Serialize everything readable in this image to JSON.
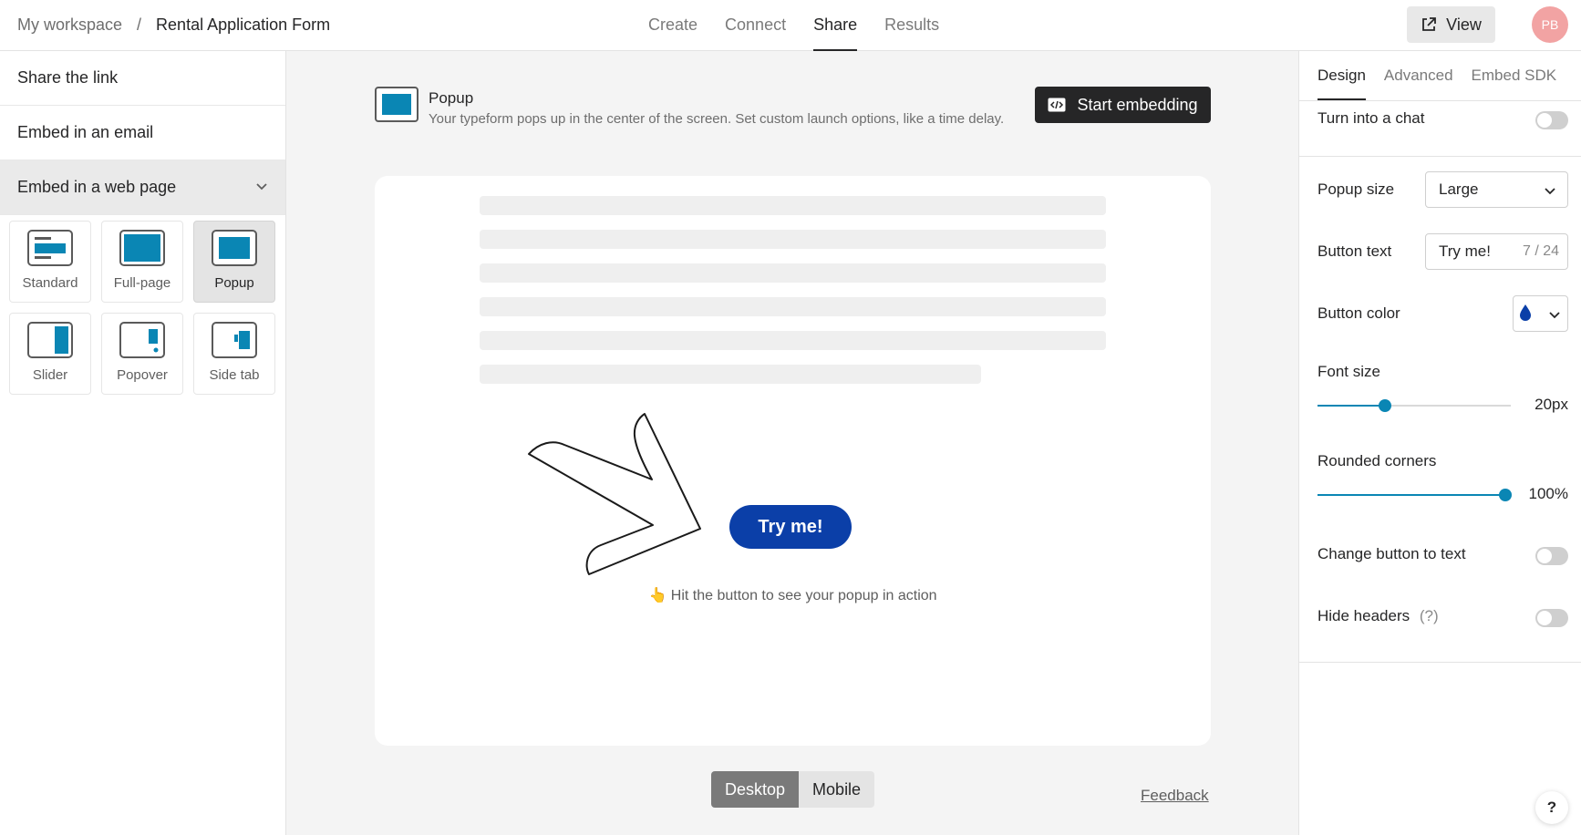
{
  "header": {
    "breadcrumb_workspace": "My workspace",
    "breadcrumb_sep": "/",
    "breadcrumb_form": "Rental Application Form",
    "nav": [
      "Create",
      "Connect",
      "Share",
      "Results"
    ],
    "view_label": "View",
    "avatar_initials": "PB"
  },
  "sidebar": {
    "items": [
      "Share the link",
      "Embed in an email",
      "Embed in a web page"
    ],
    "modes": [
      "Standard",
      "Full-page",
      "Popup",
      "Slider",
      "Popover",
      "Side tab"
    ],
    "active_mode": "Popup"
  },
  "main": {
    "title": "Popup",
    "description": "Your typeform pops up in the center of the screen. Set custom launch options, like a time delay.",
    "start_label": "Start embedding",
    "try_label": "Try me!",
    "hint": "👆 Hit the button to see your popup in action",
    "devices": [
      "Desktop",
      "Mobile"
    ],
    "feedback": "Feedback"
  },
  "panel": {
    "tabs": [
      "Design",
      "Advanced",
      "Embed SDK"
    ],
    "turn_into_chat": "Turn into a chat",
    "popup_size_label": "Popup size",
    "popup_size_value": "Large",
    "button_text_label": "Button text",
    "button_text_value": "Try me!",
    "button_text_counter": "7 / 24",
    "button_color_label": "Button color",
    "button_color": "#0b3fa8",
    "font_size_label": "Font size",
    "font_size_value": "20px",
    "font_size_fraction": 0.35,
    "rounded_label": "Rounded corners",
    "rounded_value": "100%",
    "rounded_fraction": 1.0,
    "change_button_label": "Change button to text",
    "hide_headers_label": "Hide headers",
    "hide_headers_hint": "(?)",
    "help": "?"
  }
}
